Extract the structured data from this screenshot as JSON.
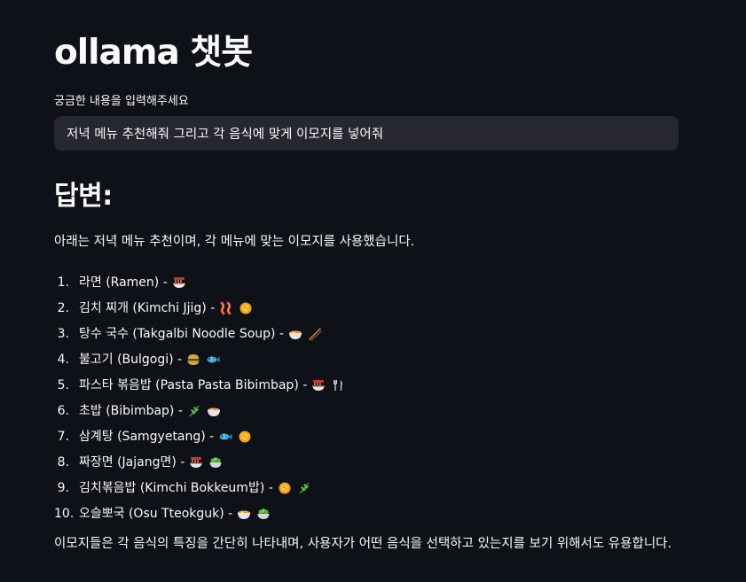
{
  "page": {
    "title": "ollama 챗봇",
    "input_label": "궁금한 내용을 입력해주세요",
    "input_value": "저녁 메뉴 추천해줘 그리고 각 음식에 맞게 이모지를 넣어줘",
    "answer_heading": "답변:",
    "intro": "아래는 저녁 메뉴 추천이며, 각 메뉴에 맞는 이모지를 사용했습니다.",
    "summary": "이모지들은 각 음식의 특징을 간단히 나타내며, 사용자가 어떤 음식을 선택하고 있는지를 보기 위해서도 유용합니다."
  },
  "menu": [
    {
      "num": "1.",
      "text": "라면 (Ramen) -",
      "emojis": [
        "noodle-bowl-icon"
      ]
    },
    {
      "num": "2.",
      "text": "김치 찌개 (Kimchi Jjig) -",
      "emojis": [
        "bacon-icon",
        "yellow-circle-icon"
      ]
    },
    {
      "num": "3.",
      "text": "탕수 국수 (Takgalbi Noodle Soup) -",
      "emojis": [
        "soup-bowl-icon",
        "chopsticks-icon"
      ]
    },
    {
      "num": "4.",
      "text": "불고기 (Bulgogi) -",
      "emojis": [
        "burger-icon",
        "fish-icon"
      ]
    },
    {
      "num": "5.",
      "text": "파스타 볶음밥 (Pasta Pasta Bibimbap) -",
      "emojis": [
        "noodle-bowl-icon",
        "fork-knife-icon"
      ]
    },
    {
      "num": "6.",
      "text": "초밥 (Bibimbap) -",
      "emojis": [
        "herb-icon",
        "soup-bowl-icon"
      ]
    },
    {
      "num": "7.",
      "text": "삼계탕 (Samgyetang) -",
      "emojis": [
        "fish-icon",
        "yellow-circle-icon"
      ]
    },
    {
      "num": "8.",
      "text": "짜장면 (Jajang면) -",
      "emojis": [
        "noodle-bowl-icon",
        "salad-icon"
      ]
    },
    {
      "num": "9.",
      "text": "김치볶음밥 (Kimchi Bokkeum밥) -",
      "emojis": [
        "yellow-circle-icon",
        "herb-icon"
      ]
    },
    {
      "num": "10.",
      "text": "오슬뽀국 (Osu Tteokguk) -",
      "emojis": [
        "soup-bowl-icon",
        "salad-icon"
      ]
    }
  ],
  "colors": {
    "background": "#0e1117",
    "input_background": "#262730",
    "text": "#fafafa"
  }
}
